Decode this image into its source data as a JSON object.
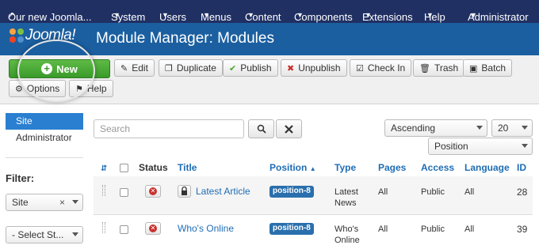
{
  "colors": {
    "topnav_bg": "#203063",
    "header_bg": "#1b5fa0",
    "new_button": "#4aa832",
    "link": "#1f6db5",
    "sidebar_active": "#2a7fd0",
    "position_badge": "#2a6fad",
    "unpublish_red": "#c9302c"
  },
  "topnav": {
    "site_link": "Our new Joomla...",
    "menus": [
      {
        "label": "System",
        "icon": "caret-down-icon"
      },
      {
        "label": "Users",
        "icon": "caret-down-icon"
      },
      {
        "label": "Menus",
        "icon": "caret-down-icon"
      },
      {
        "label": "Content",
        "icon": "caret-down-icon"
      },
      {
        "label": "Components",
        "icon": "caret-down-icon"
      },
      {
        "label": "Extensions",
        "icon": "caret-down-icon"
      },
      {
        "label": "Help",
        "icon": "caret-down-icon"
      }
    ],
    "user_menu": "Administrator"
  },
  "header": {
    "logo_text": "Joomla!",
    "title": "Module Manager: Modules"
  },
  "toolbar": {
    "new": "New",
    "edit": "Edit",
    "duplicate": "Duplicate",
    "publish": "Publish",
    "unpublish": "Unpublish",
    "check_in": "Check In",
    "trash": "Trash",
    "batch": "Batch",
    "options": "Options",
    "help": "Help"
  },
  "sidebar": {
    "items": [
      {
        "label": "Site",
        "active": true
      },
      {
        "label": "Administrator",
        "active": false
      }
    ],
    "filter_label": "Filter:",
    "client_filter": "Site",
    "state_filter": "- Select St..."
  },
  "search": {
    "placeholder": "Search",
    "search_icon": "search-icon",
    "clear_icon": "close-icon"
  },
  "list_controls": {
    "order_direction": "Ascending",
    "limit": "20",
    "sort_by": "Position"
  },
  "table": {
    "headers": {
      "status": "Status",
      "title": "Title",
      "position": "Position",
      "type": "Type",
      "pages": "Pages",
      "access": "Access",
      "language": "Language",
      "id": "ID"
    },
    "rows": [
      {
        "title": "Latest Article",
        "locked": true,
        "position": "position-8",
        "type_line1": "Latest",
        "type_line2": "News",
        "pages": "All",
        "access": "Public",
        "language": "All",
        "id": "28"
      },
      {
        "title": "Who's Online",
        "locked": false,
        "position": "position-8",
        "type_line1": "Who's",
        "type_line2": "Online",
        "pages": "All",
        "access": "Public",
        "language": "All",
        "id": "39"
      }
    ]
  }
}
